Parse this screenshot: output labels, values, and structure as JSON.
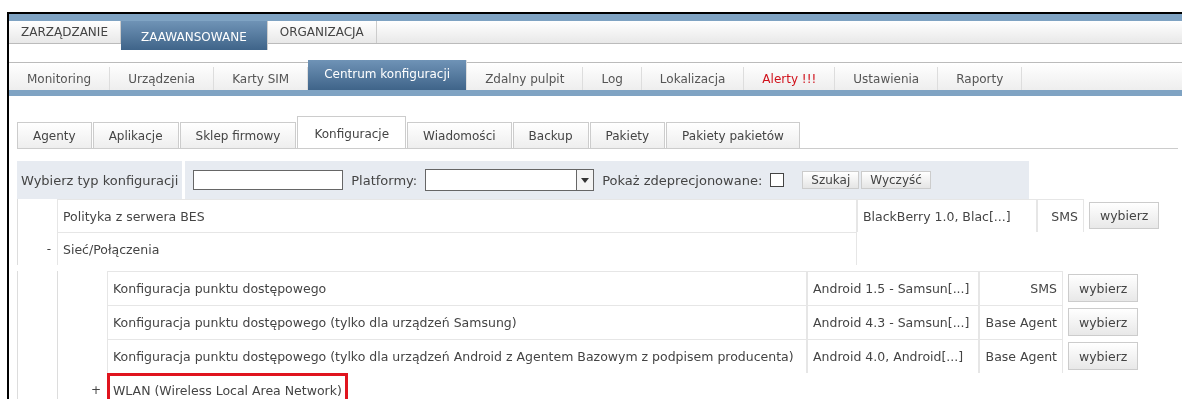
{
  "main_tabs": [
    {
      "label": "ZARZĄDZANIE",
      "selected": false
    },
    {
      "label": "ZAAWANSOWANE",
      "selected": true
    },
    {
      "label": "ORGANIZACJA",
      "selected": false
    }
  ],
  "section_tabs": [
    {
      "label": "Monitoring",
      "selected": false,
      "alert": false
    },
    {
      "label": "Urządzenia",
      "selected": false,
      "alert": false
    },
    {
      "label": "Karty SIM",
      "selected": false,
      "alert": false
    },
    {
      "label": "Centrum konfiguracji",
      "selected": true,
      "alert": false
    },
    {
      "label": "Zdalny pulpit",
      "selected": false,
      "alert": false
    },
    {
      "label": "Log",
      "selected": false,
      "alert": false
    },
    {
      "label": "Lokalizacja",
      "selected": false,
      "alert": false
    },
    {
      "label": "Alerty !!!",
      "selected": false,
      "alert": true
    },
    {
      "label": "Ustawienia",
      "selected": false,
      "alert": false
    },
    {
      "label": "Raporty",
      "selected": false,
      "alert": false
    }
  ],
  "sub_tabs": [
    {
      "label": "Agenty",
      "selected": false
    },
    {
      "label": "Aplikacje",
      "selected": false
    },
    {
      "label": "Sklep firmowy",
      "selected": false
    },
    {
      "label": "Konfiguracje",
      "selected": true
    },
    {
      "label": "Wiadomości",
      "selected": false
    },
    {
      "label": "Backup",
      "selected": false
    },
    {
      "label": "Pakiety",
      "selected": false
    },
    {
      "label": "Pakiety pakietów",
      "selected": false
    }
  ],
  "filter": {
    "type_label": "Wybierz typ konfiguracji",
    "platform_label": "Platformy:",
    "deprecated_label": "Pokaż zdeprecjonowane:",
    "deprecated_checked": false,
    "buttons": [
      "Szukaj",
      "Wyczyść"
    ]
  },
  "tree": [
    {
      "label": "Polityka z serwera BES",
      "platforms": "BlackBerry 1.0, Blac[...]",
      "agent": "SMS",
      "action": "wybierz",
      "highlighted": false
    },
    {
      "label": "Sieć/Połączenia",
      "toggle": "-",
      "highlighted": false,
      "children": [
        {
          "label": "Konfiguracja punktu dostępowego",
          "platforms": "Android 1.5 - Samsun[...]",
          "agent": "SMS",
          "action": "wybierz",
          "highlighted": false
        },
        {
          "label": "Konfiguracja punktu dostępowego (tylko dla urządzeń Samsung)",
          "platforms": "Android 4.3 - Samsun[...]",
          "agent": "Base Agent",
          "action": "wybierz",
          "highlighted": false
        },
        {
          "label": "Konfiguracja punktu dostępowego (tylko dla urządzeń Android z Agentem Bazowym z podpisem producenta)",
          "platforms": "Android 4.0, Android[...]",
          "agent": "Base Agent",
          "action": "wybierz",
          "highlighted": false
        },
        {
          "label": "WLAN (Wireless Local Area Network)",
          "toggle": "+",
          "highlighted": true
        }
      ]
    }
  ]
}
